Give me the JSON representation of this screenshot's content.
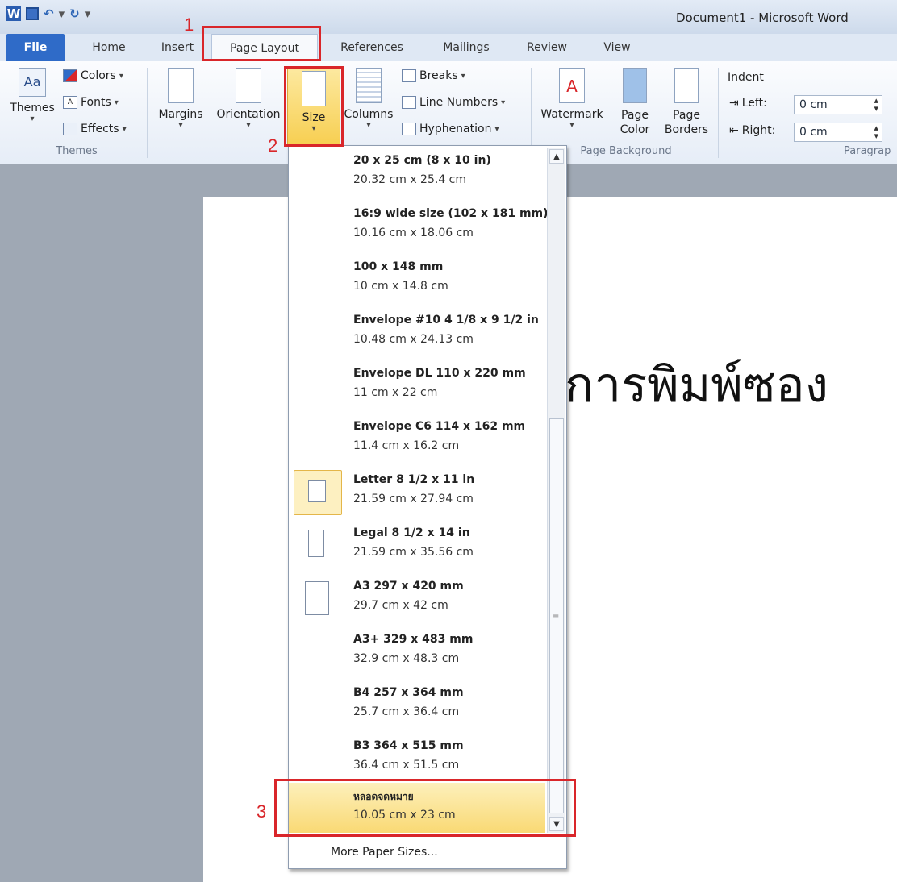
{
  "window": {
    "title": "Document1 - Microsoft Word"
  },
  "tabs": {
    "file": "File",
    "home": "Home",
    "insert": "Insert",
    "page_layout": "Page Layout",
    "references": "References",
    "mailings": "Mailings",
    "review": "Review",
    "view": "View"
  },
  "ribbon": {
    "themes": {
      "themes": "Themes",
      "colors": "Colors",
      "fonts": "Fonts",
      "effects": "Effects",
      "group": "Themes"
    },
    "page_setup": {
      "margins": "Margins",
      "orientation": "Orientation",
      "size": "Size",
      "columns": "Columns",
      "breaks": "Breaks",
      "line_numbers": "Line Numbers",
      "hyphenation": "Hyphenation"
    },
    "page_background": {
      "watermark": "Watermark",
      "page_color_1": "Page",
      "page_color_2": "Color",
      "page_borders_1": "Page",
      "page_borders_2": "Borders",
      "group": "Page Background"
    },
    "paragraph": {
      "indent": "Indent",
      "left": "Left:",
      "left_value": "0 cm",
      "right": "Right:",
      "right_value": "0 cm",
      "group": "Paragrap"
    }
  },
  "size_menu": {
    "items": [
      {
        "name": "20 x 25 cm (8 x 10 in)",
        "dims": "20.32 cm x 25.4 cm"
      },
      {
        "name": "16:9 wide size (102 x 181 mm)",
        "dims": "10.16 cm x 18.06 cm"
      },
      {
        "name": "100 x 148 mm",
        "dims": "10 cm x 14.8 cm"
      },
      {
        "name": "Envelope #10 4 1/8 x 9 1/2 in",
        "dims": "10.48 cm x 24.13 cm"
      },
      {
        "name": "Envelope DL  110 x 220 mm",
        "dims": "11 cm x 22 cm"
      },
      {
        "name": "Envelope C6  114 x 162 mm",
        "dims": "11.4 cm x 16.2 cm"
      },
      {
        "name": "Letter 8 1/2 x 11 in",
        "dims": "21.59 cm x 27.94 cm"
      },
      {
        "name": "Legal 8 1/2 x 14 in",
        "dims": "21.59 cm x 35.56 cm"
      },
      {
        "name": "A3 297 x 420 mm",
        "dims": "29.7 cm x 42 cm"
      },
      {
        "name": "A3+ 329 x 483 mm",
        "dims": "32.9 cm x 48.3 cm"
      },
      {
        "name": "B4 257 x 364 mm",
        "dims": "25.7 cm x 36.4 cm"
      },
      {
        "name": "B3 364 x 515 mm",
        "dims": "36.4 cm x 51.5 cm"
      },
      {
        "name": "หลอดจดหมาย",
        "dims": "10.05 cm x 23 cm"
      }
    ],
    "more": "More Paper Sizes..."
  },
  "document": {
    "text": "การพิมพ์ซอง"
  },
  "annotations": {
    "n1": "1",
    "n2": "2",
    "n3": "3"
  },
  "colors": {
    "accent": "#2f6bc8",
    "highlight": "#f9d974",
    "annotation": "#d9262a"
  }
}
